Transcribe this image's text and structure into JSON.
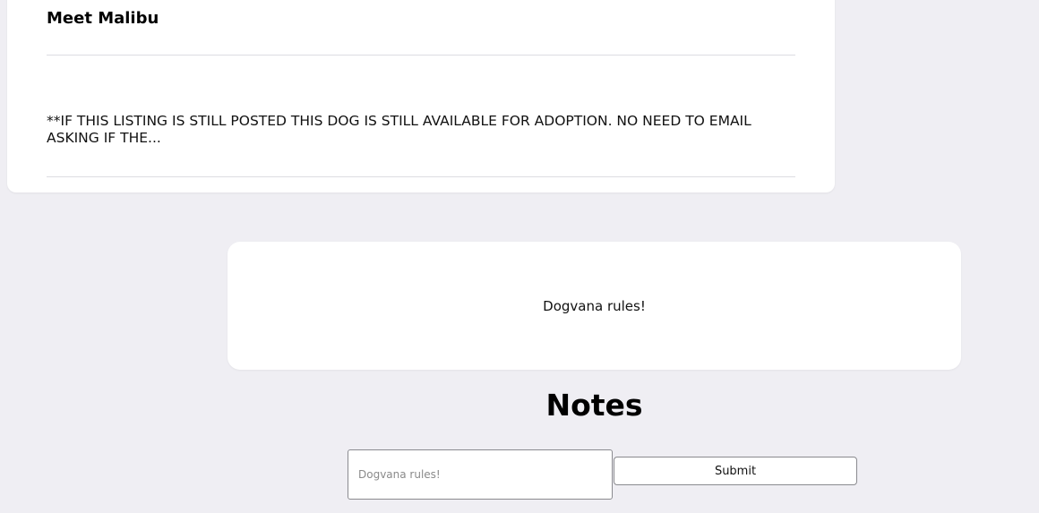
{
  "listing": {
    "title": "Meet Malibu",
    "description": "**IF THIS LISTING IS STILL POSTED THIS DOG IS STILL AVAILABLE FOR ADOPTION. NO NEED TO EMAIL ASKING IF THE..."
  },
  "note_card": {
    "text": "Dogvana rules!"
  },
  "notes": {
    "heading": "Notes",
    "input_placeholder": "Dogvana rules!",
    "submit_label": "Submit"
  },
  "colors": {
    "background": "#efeef3",
    "card": "#ffffff",
    "border": "#8a8a8f"
  }
}
